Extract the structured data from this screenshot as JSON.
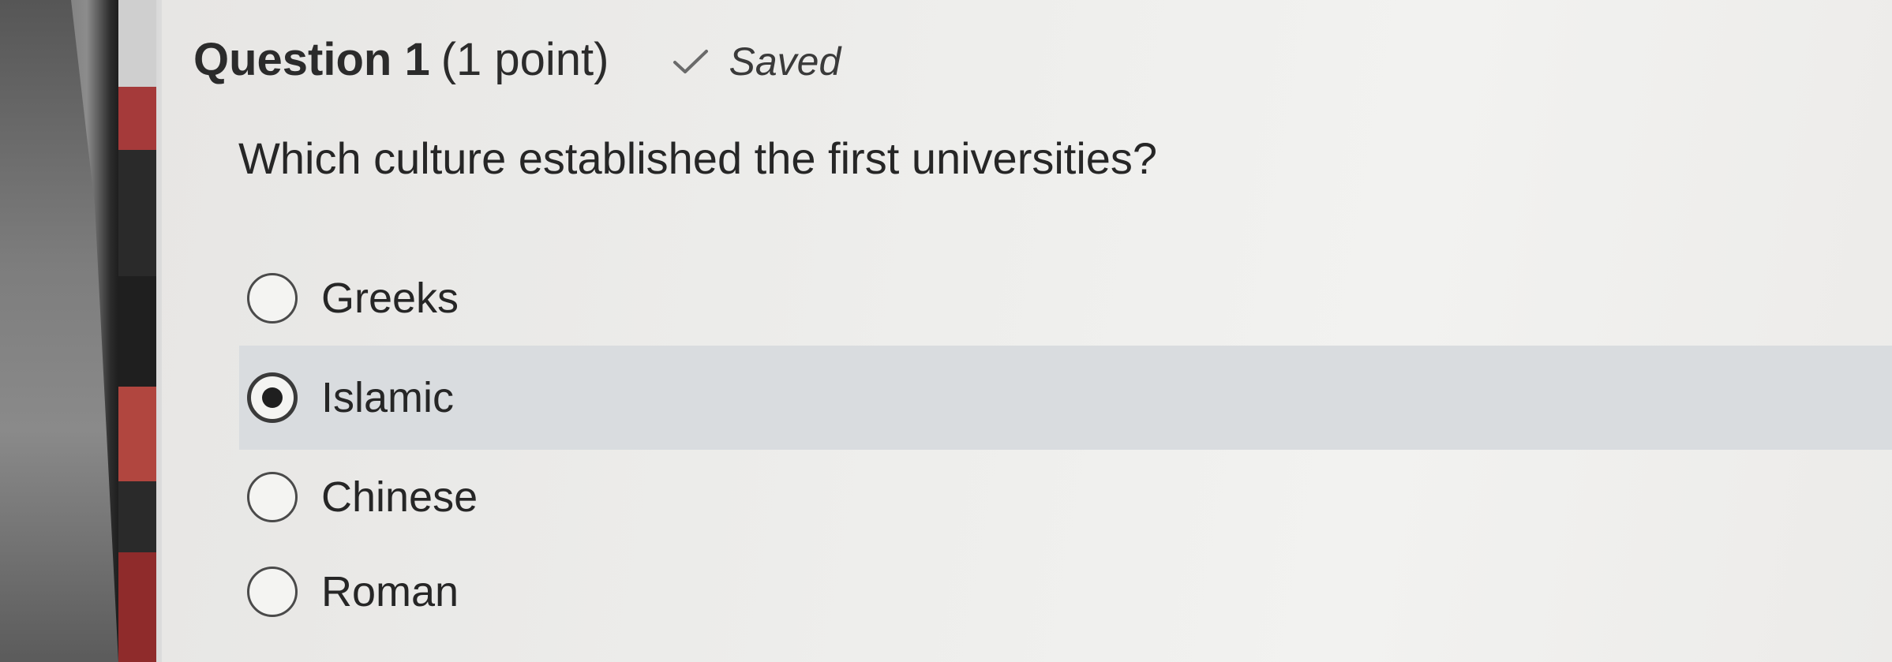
{
  "question": {
    "title": "Question 1",
    "points": "(1 point)",
    "status": "Saved",
    "status_icon": "check-icon",
    "prompt": "Which culture established the first universities?"
  },
  "options": [
    {
      "label": "Greeks",
      "selected": false
    },
    {
      "label": "Islamic",
      "selected": true
    },
    {
      "label": "Chinese",
      "selected": false
    },
    {
      "label": "Roman",
      "selected": false
    }
  ],
  "colors": {
    "selected_row": "#d9dcdf",
    "text": "#262626"
  }
}
